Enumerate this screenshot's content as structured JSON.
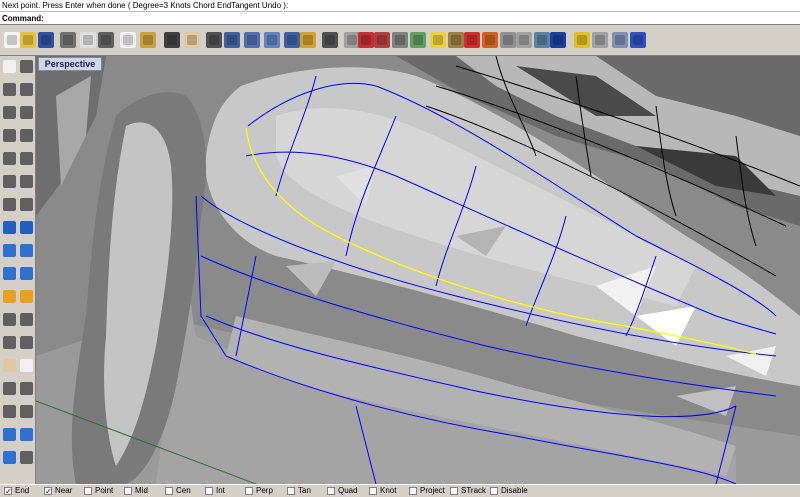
{
  "prompt": {
    "text": "Next point. Press Enter when done ( Degree=3  Knots  Chord  EndTangent  Undo ):"
  },
  "command": {
    "label": "Command:",
    "value": ""
  },
  "toolbar": {
    "buttons": [
      {
        "icon": "new-file-icon",
        "color": "#f4f4f4"
      },
      {
        "icon": "open-folder-icon",
        "color": "#e8c040"
      },
      {
        "icon": "save-disk-icon",
        "color": "#3050a0"
      },
      {
        "icon": "print-icon",
        "color": "#707070"
      },
      {
        "icon": "copy-page-icon",
        "color": "#e0e0e0"
      },
      {
        "icon": "cut-scissors-icon",
        "color": "#606060"
      },
      {
        "icon": "copy-icon",
        "color": "#f0f0f0"
      },
      {
        "icon": "paste-icon",
        "color": "#d0a040"
      },
      {
        "icon": "undo-icon",
        "color": "#404040"
      },
      {
        "icon": "hand-pan-icon",
        "color": "#e0c8a0"
      },
      {
        "icon": "move-arrows-icon",
        "color": "#505050"
      },
      {
        "icon": "zoom-icon",
        "color": "#4060a0"
      },
      {
        "icon": "zoom-window-icon",
        "color": "#5070b0"
      },
      {
        "icon": "zoom-dynamic-icon",
        "color": "#6080c0"
      },
      {
        "icon": "zoom-extents-icon",
        "color": "#4060a0"
      },
      {
        "icon": "zoom-selected-icon",
        "color": "#d0a030"
      },
      {
        "icon": "rotate-view-icon",
        "color": "#505050"
      },
      {
        "icon": "grid-plane-icon",
        "color": "#a0a0a0"
      },
      {
        "icon": "point-pencil-icon",
        "color": "#c03030"
      },
      {
        "icon": "car-icon",
        "color": "#b04040"
      },
      {
        "icon": "layer-icon",
        "color": "#808080"
      },
      {
        "icon": "properties-icon",
        "color": "#60a060"
      },
      {
        "icon": "light-bulb-icon",
        "color": "#e8d040"
      },
      {
        "icon": "lock-icon",
        "color": "#a08040"
      },
      {
        "icon": "color-palette-icon",
        "color": "#d03030"
      },
      {
        "icon": "cube-icon",
        "color": "#d06020"
      },
      {
        "icon": "render-sphere-icon",
        "color": "#909090"
      },
      {
        "icon": "shaded-sphere-icon",
        "color": "#a0a0a0"
      },
      {
        "icon": "material-sphere-icon",
        "color": "#6080a0"
      },
      {
        "icon": "globe-icon",
        "color": "#2040a0"
      },
      {
        "icon": "star-icon",
        "color": "#e0c020"
      },
      {
        "icon": "tools-icon",
        "color": "#a0a0a0"
      },
      {
        "icon": "options-icon",
        "color": "#8090b0"
      },
      {
        "icon": "help-icon",
        "color": "#3050c0"
      }
    ]
  },
  "left_tools": [
    {
      "icon": "select-arrow-icon",
      "color": "#f0f0f0"
    },
    {
      "icon": "point-icon",
      "color": "#606060"
    },
    {
      "icon": "line-icon",
      "color": "#606060"
    },
    {
      "icon": "polyline-icon",
      "color": "#606060"
    },
    {
      "icon": "curve-icon",
      "color": "#606060"
    },
    {
      "icon": "circle-icon",
      "color": "#606060"
    },
    {
      "icon": "arc-icon",
      "color": "#606060"
    },
    {
      "icon": "ellipse-icon",
      "color": "#606060"
    },
    {
      "icon": "rectangle-icon",
      "color": "#606060"
    },
    {
      "icon": "polygon-icon",
      "color": "#606060"
    },
    {
      "icon": "free-curve-icon",
      "color": "#606060"
    },
    {
      "icon": "fillet-icon",
      "color": "#606060"
    },
    {
      "icon": "offset-icon",
      "color": "#606060"
    },
    {
      "icon": "surface-corner-icon",
      "color": "#606060"
    },
    {
      "icon": "surface-edge-icon",
      "color": "#2060c0"
    },
    {
      "icon": "loft-icon",
      "color": "#2060c0"
    },
    {
      "icon": "box-solid-icon",
      "color": "#3070d0"
    },
    {
      "icon": "sphere-solid-icon",
      "color": "#3070d0"
    },
    {
      "icon": "extrude-icon",
      "color": "#3070d0"
    },
    {
      "icon": "boolean-icon",
      "color": "#3070d0"
    },
    {
      "icon": "mesh-icon",
      "color": "#e8a020"
    },
    {
      "icon": "fire-icon",
      "color": "#e8a020"
    },
    {
      "icon": "split-icon",
      "color": "#606060"
    },
    {
      "icon": "trim-icon",
      "color": "#606060"
    },
    {
      "icon": "join-icon",
      "color": "#606060"
    },
    {
      "icon": "explode-icon",
      "color": "#606060"
    },
    {
      "icon": "hand-tool-icon",
      "color": "#e0c8a0"
    },
    {
      "icon": "cursor-pointer-icon",
      "color": "#f0f0f0"
    },
    {
      "icon": "cylinder-icon",
      "color": "#606060"
    },
    {
      "icon": "group-icon",
      "color": "#606060"
    },
    {
      "icon": "dimension-icon",
      "color": "#606060"
    },
    {
      "icon": "text-icon",
      "color": "#606060"
    },
    {
      "icon": "sphere-blue-icon",
      "color": "#3070d0"
    },
    {
      "icon": "analyze-icon",
      "color": "#3070d0"
    },
    {
      "icon": "render-icon",
      "color": "#3070d0"
    },
    {
      "icon": "layout-icon",
      "color": "#606060"
    }
  ],
  "viewport": {
    "label": "Perspective",
    "curve_color": "#ffff00",
    "iso_color": "#0000ff",
    "mesh_edge_color": "#000000",
    "grid_color": "#3a6a3a"
  },
  "status": {
    "snaps": [
      {
        "label": "End",
        "checked": true
      },
      {
        "label": "Near",
        "checked": true
      },
      {
        "label": "Point",
        "checked": false
      },
      {
        "label": "Mid",
        "checked": false
      },
      {
        "label": "Cen",
        "checked": false
      },
      {
        "label": "Int",
        "checked": false
      },
      {
        "label": "Perp",
        "checked": false
      },
      {
        "label": "Tan",
        "checked": false
      },
      {
        "label": "Quad",
        "checked": false
      },
      {
        "label": "Knot",
        "checked": false
      },
      {
        "label": "Project",
        "checked": false
      },
      {
        "label": "STrack",
        "checked": false
      },
      {
        "label": "Disable",
        "checked": false
      }
    ]
  }
}
